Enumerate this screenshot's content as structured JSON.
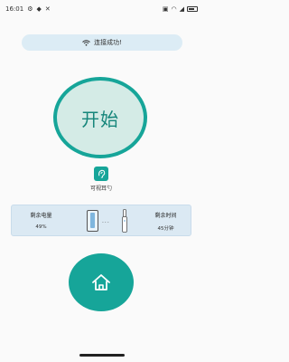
{
  "status_bar": {
    "time": "16:01",
    "icons_left": [
      "settings-icon",
      "location-icon",
      "no-signal-icon"
    ],
    "icons_right": [
      "sim-icon",
      "wifi-icon",
      "signal-icon",
      "battery-icon"
    ]
  },
  "toast": {
    "icon": "wifi-icon",
    "text": "连接成功!"
  },
  "start_button": {
    "label": "开始"
  },
  "mode": {
    "icon": "ear-icon",
    "label": "可视耳勺"
  },
  "info": {
    "battery_title": "剩余电量",
    "battery_value": "49%",
    "time_title": "剩余时间",
    "time_value": "45分钟",
    "connector": "···"
  },
  "home_button": {
    "icon": "home-icon"
  },
  "colors": {
    "accent": "#16a599",
    "card": "#dbe9f3"
  }
}
